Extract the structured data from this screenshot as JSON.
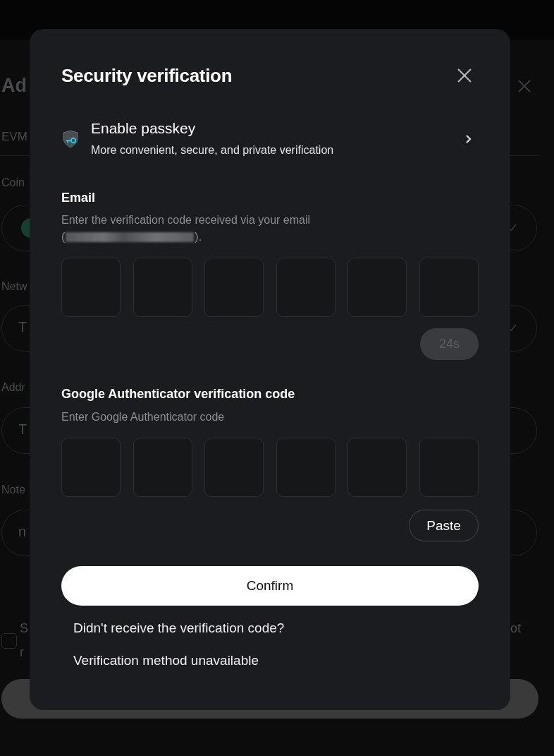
{
  "background": {
    "title": "Ad",
    "tab": "EVM",
    "fields": [
      {
        "label": "Coin",
        "kind": "coin"
      },
      {
        "label": "Netw",
        "value": "T",
        "kind": "select"
      },
      {
        "label": "Addr",
        "value": "T",
        "kind": "text"
      },
      {
        "label": "Note",
        "value": "n",
        "kind": "text"
      }
    ],
    "checkbox": {
      "checked": false,
      "text_lines": [
        "S",
        "r"
      ],
      "text_end": "ot"
    }
  },
  "dialog": {
    "title": "Security verification",
    "passkey": {
      "title": "Enable passkey",
      "subtitle": "More convenient, secure, and private verification"
    },
    "email": {
      "label": "Email",
      "description": "Enter the verification code received via your email",
      "email_open": "(",
      "email_masked": true,
      "email_close": ").",
      "boxes": [
        {
          "focused": false
        },
        {
          "focused": false
        },
        {
          "focused": false
        },
        {
          "focused": false
        },
        {
          "focused": false
        },
        {
          "focused": false
        }
      ],
      "resend": {
        "label": "24s",
        "disabled": true
      }
    },
    "authenticator": {
      "label": "Google Authenticator verification code",
      "description": "Enter Google Authenticator code",
      "boxes": [
        {
          "focused": false
        },
        {
          "focused": false
        },
        {
          "focused": false
        },
        {
          "focused": false
        },
        {
          "focused": false
        },
        {
          "focused": false
        }
      ],
      "paste": "Paste"
    },
    "confirm": "Confirm",
    "links": [
      "Didn't receive the verification code?",
      "Verification method unavailable"
    ]
  }
}
